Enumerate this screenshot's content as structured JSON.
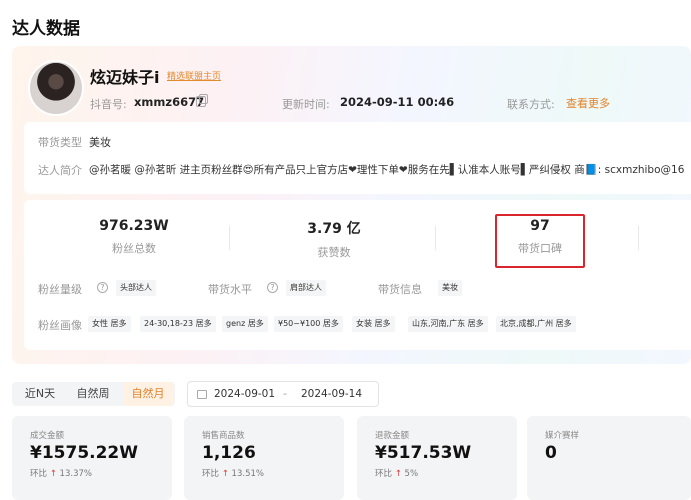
{
  "page_title": "达人数据",
  "profile": {
    "name": "炫迈妹子i",
    "join_link": "精选联盟主页",
    "account_label": "抖音号:",
    "account_value": "xmmz6677",
    "update_label": "更新时间:",
    "update_value": "2024-09-11 00:46",
    "contact_label": "联系方式:",
    "contact_link": "查看更多",
    "category_label": "带货类型",
    "category_value": "美妆",
    "bio_label": "达人简介",
    "bio_value": "@孙茗暖 @孙茗昕 进主页粉丝群😍所有产品只上官方店❤理性下单❤服务在先▌认准本人账号▌严纠侵权 商📘: scxmzhibo@16"
  },
  "stats": [
    {
      "value": "976.23W",
      "label": "粉丝总数"
    },
    {
      "value": "3.79 亿",
      "label": "获赞数"
    },
    {
      "value": "97",
      "label": "带货口碑"
    }
  ],
  "tags": {
    "fan_level_label": "粉丝量级",
    "fan_level_chip": "头部达人",
    "sales_level_label": "带货水平",
    "sales_level_chip": "肩部达人",
    "sales_info_label": "带货信息",
    "sales_info_chip": "美妆",
    "fan_profile_label": "粉丝画像",
    "fan_profile_chips": [
      "女性 居多",
      "24-30,18-23 居多",
      "genz 居多",
      "¥50~¥100 居多",
      "女装 居多",
      "山东,河南,广东 居多",
      "北京,成都,广州 居多"
    ]
  },
  "help_glyph": "?",
  "range_tabs": [
    {
      "label": "近N天",
      "active": false
    },
    {
      "label": "自然周",
      "active": false
    },
    {
      "label": "自然月",
      "active": true
    }
  ],
  "date_range": {
    "start": "2024-09-01",
    "separator": "-",
    "end": "2024-09-14"
  },
  "metrics": [
    {
      "label": "成交金额",
      "value": "¥1575.22W",
      "ratio_label": "环比",
      "arrow": "↑",
      "ratio": "13.37%"
    },
    {
      "label": "销售商品数",
      "value": "1,126",
      "ratio_label": "环比",
      "arrow": "↑",
      "ratio": "13.51%"
    },
    {
      "label": "退款金额",
      "value": "¥517.53W",
      "ratio_label": "环比",
      "arrow": "↑",
      "ratio": "5%"
    },
    {
      "label": "媒介赛样",
      "value": "0",
      "ratio_label": "",
      "arrow": "",
      "ratio": ""
    }
  ],
  "colors": {
    "accent": "#e2822a",
    "highlight_border": "#d9262c",
    "ratio_up": "#e23a3a"
  }
}
